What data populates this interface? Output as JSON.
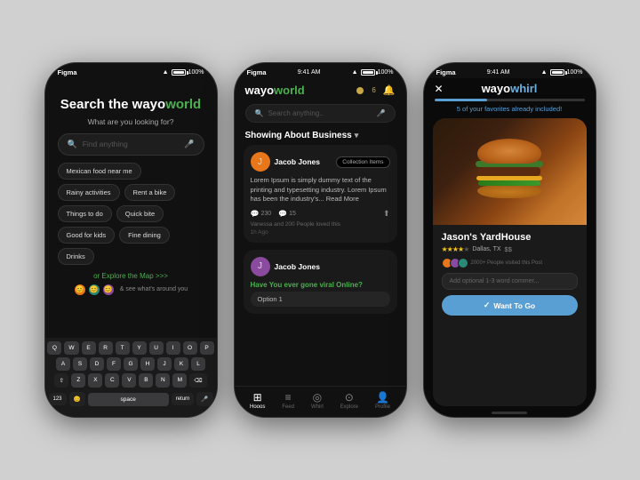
{
  "page": {
    "background": "#d0d0d0"
  },
  "phone1": {
    "status": {
      "app": "Figma",
      "time": "",
      "battery": "100%",
      "signal": "●●●"
    },
    "title": "Search the wayo",
    "title_highlight": "world",
    "subtitle": "What are you looking for?",
    "search_placeholder": "Find anything",
    "chips": [
      "Mexican food near me",
      "Rainy activities",
      "Rent a bike",
      "Things to do",
      "Quick bite",
      "Good for kids",
      "Fine dining",
      "Drinks"
    ],
    "explore_text": "or Explore the Map >>>",
    "see_whats": "& see what's around you",
    "keyboard_rows": [
      [
        "Q",
        "W",
        "E",
        "R",
        "T",
        "Y",
        "U",
        "I",
        "O",
        "P"
      ],
      [
        "A",
        "S",
        "D",
        "F",
        "G",
        "H",
        "J",
        "K",
        "L"
      ],
      [
        "Z",
        "X",
        "C",
        "V",
        "B",
        "N",
        "M"
      ]
    ],
    "kb_123": "123",
    "kb_space": "space",
    "kb_return": "return"
  },
  "phone2": {
    "status": {
      "app": "Figma",
      "time": "9:41 AM",
      "battery": "100%"
    },
    "logo": "wayo",
    "logo_highlight": "world",
    "dot_count": "6",
    "search_placeholder": "Search anything..",
    "showing": "Showing About Business",
    "posts": [
      {
        "user": "Jacob Jones",
        "button": "Collection Items",
        "text": "Lorem Ipsum is simply dummy text of the printing and typesetting industry. Lorem Ipsum has been the industry's... Read More",
        "likes": 230,
        "comments": 15,
        "liked_text": "Vanessa and 200 People loved this",
        "time": "1h Ago"
      },
      {
        "user": "Jacob Jones",
        "question": "Have You ever gone viral Online?",
        "option": "Option 1"
      }
    ],
    "nav": [
      {
        "icon": "⊞",
        "label": "Hooos",
        "active": true
      },
      {
        "icon": "☰",
        "label": "Feed"
      },
      {
        "icon": "◎",
        "label": "Whirl"
      },
      {
        "icon": "🔍",
        "label": "Explore"
      },
      {
        "icon": "👤",
        "label": "Profile"
      }
    ]
  },
  "phone3": {
    "status": {
      "app": "Figma",
      "time": "9:41 AM",
      "battery": "100%"
    },
    "logo": "wayo",
    "logo_highlight": "whirl",
    "progress": 35,
    "favorites_text": "5 of your favorites already included!",
    "restaurant": {
      "name": "Jason's YardHouse",
      "stars": 4,
      "location": "Dallas, TX",
      "price": "$$",
      "visited_text": "2000+ People visited this Post",
      "comment_placeholder": "Add optional 1-3 word commer...",
      "cta": "Want To Go"
    }
  }
}
